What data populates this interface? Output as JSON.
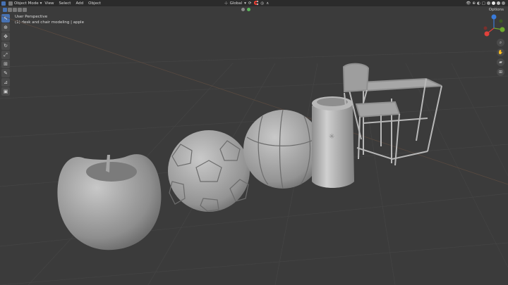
{
  "header": {
    "mode_label": "Object Mode",
    "menu": [
      "View",
      "Select",
      "Add",
      "Object"
    ],
    "transform_orientation": "Global",
    "options_label": "Options"
  },
  "toolbar": {
    "tools": [
      {
        "name": "select-box-tool",
        "glyph": "↖",
        "active": true
      },
      {
        "name": "cursor-tool",
        "glyph": "⊕"
      },
      {
        "name": "move-tool",
        "glyph": "✥"
      },
      {
        "name": "rotate-tool",
        "glyph": "↻"
      },
      {
        "name": "scale-tool",
        "glyph": "⤢"
      },
      {
        "name": "transform-tool",
        "glyph": "⊞"
      },
      {
        "name": "annotate-tool",
        "glyph": "✎"
      },
      {
        "name": "measure-tool",
        "glyph": "⊿"
      },
      {
        "name": "add-cube-tool",
        "glyph": "▣"
      }
    ]
  },
  "viewport": {
    "view_name": "User Perspective",
    "collection_info": "(1) desk and chair modeling | apple"
  },
  "navigation": {
    "gizmo_axes": [
      "X",
      "Y",
      "Z"
    ],
    "axis_colors": {
      "x": "#e0413b",
      "y": "#6da92d",
      "z": "#3a7bdb"
    }
  }
}
